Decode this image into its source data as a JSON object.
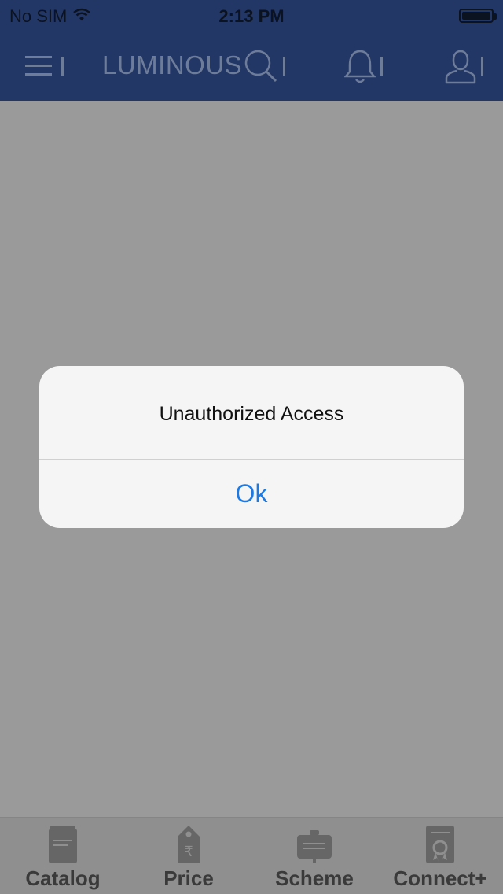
{
  "status_bar": {
    "carrier": "No SIM",
    "time": "2:13 PM",
    "wifi_icon": "wifi-icon",
    "battery_icon": "battery-icon"
  },
  "header": {
    "brand": "LUMINOUS",
    "menu_icon": "hamburger-menu-icon",
    "search_icon": "search-icon",
    "notification_icon": "bell-icon",
    "profile_icon": "user-profile-icon",
    "background_color": "#233767"
  },
  "alert": {
    "message": "Unauthorized Access",
    "ok_label": "Ok",
    "button_color": "#1d7ae2"
  },
  "tab_bar": {
    "tabs": [
      {
        "label": "Catalog",
        "icon": "catalog-icon"
      },
      {
        "label": "Price",
        "icon": "price-tag-icon"
      },
      {
        "label": "Scheme",
        "icon": "scheme-board-icon"
      },
      {
        "label": "Connect+",
        "icon": "certificate-icon"
      }
    ]
  }
}
